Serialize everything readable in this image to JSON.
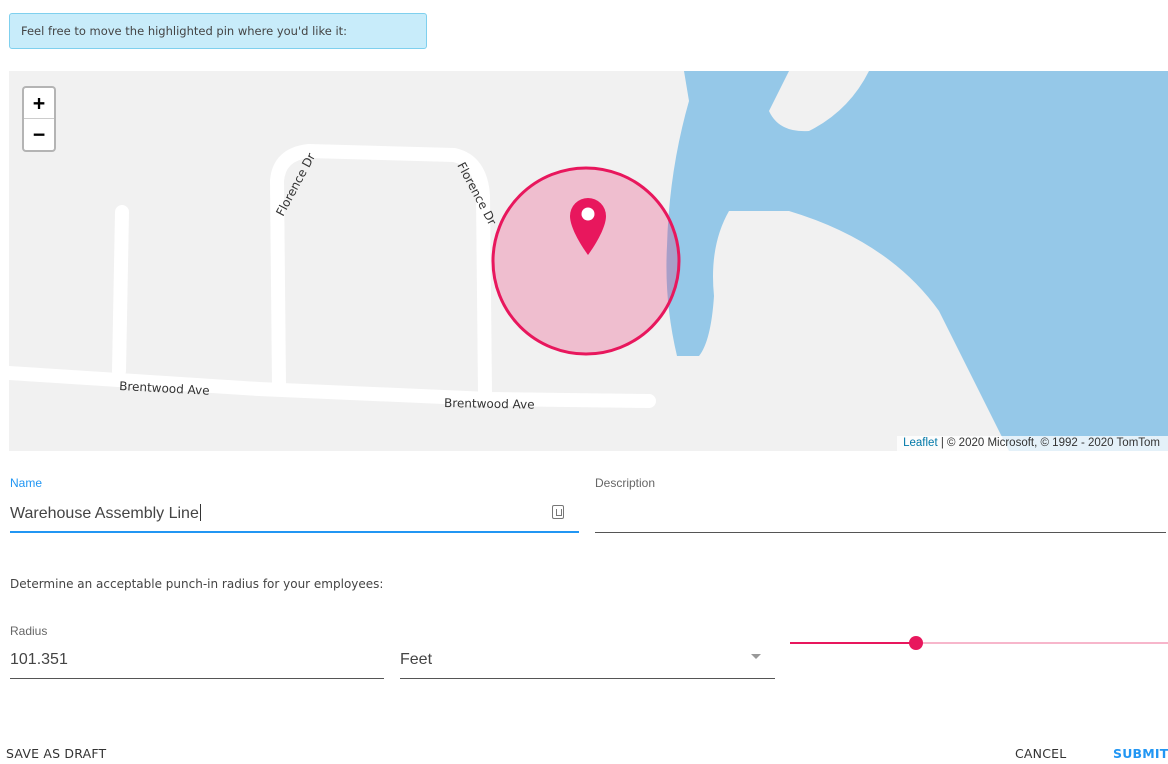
{
  "hint": "Feel free to move the highlighted pin where you'd like it:",
  "map": {
    "zoom_in": "+",
    "zoom_out": "−",
    "street_labels": {
      "florence_left": "Florence Dr",
      "florence_right": "Florence Dr",
      "brentwood_left": "Brentwood Ave",
      "brentwood_right": "Brentwood Ave"
    },
    "attribution": {
      "link": "Leaflet",
      "text": " | © 2020 Microsoft, © 1992 - 2020 TomTom"
    },
    "colors": {
      "water": "#95c8e8",
      "land": "#f1f1f1",
      "road": "#ffffff",
      "marker": "#e8175d"
    }
  },
  "form": {
    "name": {
      "label": "Name",
      "value": "Warehouse Assembly Line"
    },
    "description": {
      "label": "Description",
      "value": ""
    },
    "radius_prompt": "Determine an acceptable punch-in radius for your employees:",
    "radius": {
      "label": "Radius",
      "value": "101.351"
    },
    "unit": {
      "value": "Feet"
    },
    "slider": {
      "fraction": 0.34
    }
  },
  "actions": {
    "save_draft": "SAVE AS DRAFT",
    "cancel": "CANCEL",
    "submit": "SUBMIT"
  }
}
